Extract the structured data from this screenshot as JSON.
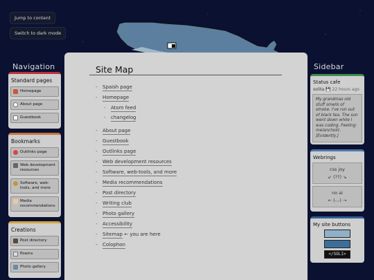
{
  "skip_links": {
    "jump": "Jump to content",
    "dark_mode": "Switch to dark mode"
  },
  "navigation": {
    "title": "Navigation",
    "sections": [
      {
        "title": "Standard pages",
        "color": "#b8323a",
        "links": [
          {
            "label": "Homepage",
            "icon": "house-icon"
          },
          {
            "label": "About page",
            "icon": "question-icon"
          },
          {
            "label": "Guestbook",
            "icon": "book-icon"
          }
        ]
      },
      {
        "title": "Bookmarks",
        "color": "#c8743a",
        "links": [
          {
            "label": "Outlinks page",
            "icon": "heart-icon"
          },
          {
            "label": "Web development resources",
            "icon": "tools-icon"
          },
          {
            "label": "Software, web-tools, and more",
            "icon": "gear-icon"
          },
          {
            "label": "Media recommendations",
            "icon": "media-icon"
          }
        ]
      },
      {
        "title": "Creations",
        "color": "#d5a23c",
        "links": [
          {
            "label": "Post directory",
            "icon": "notebook-icon"
          },
          {
            "label": "Poems",
            "icon": "quill-icon"
          },
          {
            "label": "Photo gallery",
            "icon": "photo-icon"
          }
        ]
      }
    ]
  },
  "main": {
    "title": "Site Map",
    "items": [
      {
        "label": "Spaish page",
        "level": 0
      },
      {
        "label": "Homepage",
        "level": 0
      },
      {
        "label": "Atom feed",
        "level": 1
      },
      {
        "label": "changelog",
        "level": 1
      },
      {
        "label": "About page",
        "level": 0
      },
      {
        "label": "Guestbook",
        "level": 0
      },
      {
        "label": "Outlinks page",
        "level": 0
      },
      {
        "label": "Web development resources",
        "level": 0
      },
      {
        "label": "Software, web-tools, and more",
        "level": 0
      },
      {
        "label": "Media recommendations",
        "level": 0
      },
      {
        "label": "Post directory",
        "level": 0
      },
      {
        "label": "Writing club",
        "level": 0
      },
      {
        "label": "Photo gallery",
        "level": 0
      },
      {
        "label": "Accessibility",
        "level": 0
      },
      {
        "label": "Sitemap",
        "suffix": "← you are here",
        "level": 0
      },
      {
        "label": "Colophon",
        "level": 0
      }
    ]
  },
  "sidebar": {
    "title": "Sidebar",
    "status": {
      "title": "Status cafe",
      "user": "solita",
      "time": "22 hours ago",
      "text": "My grandmas old stuff smells of smoke. I've run out of black tea. The sun went down while I was coding. Feeling: melancholic. [Evidently.]"
    },
    "webrings": {
      "title": "Webrings",
      "rings": [
        {
          "name": "css joy",
          "nav": "↙ (??) ↘"
        },
        {
          "name": "no ai",
          "nav": "← (-.-) →"
        }
      ]
    },
    "buttons": {
      "title": "My site buttons",
      "third_label": "</SOLI>"
    }
  },
  "colors": {
    "background": "#0b1130",
    "panel": "#d3d3d3",
    "whale": "#5c7fa0"
  }
}
